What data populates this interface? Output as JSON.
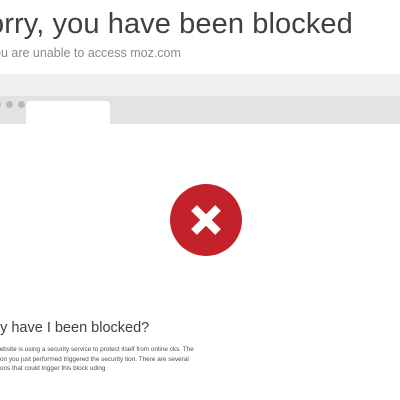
{
  "header": {
    "title": "orry, you have been blocked",
    "subtitle": "ou are unable to access moz.com"
  },
  "browser_mock": {
    "dots": [
      "dot",
      "dot",
      "dot"
    ]
  },
  "blocked_icon": {
    "icon": "close-x-icon",
    "color": "#c4222a"
  },
  "why_section": {
    "title": "hy have I been blocked?",
    "body": "s website is using a security service to protect itself from online cks. The action you just performed triggered the security tion. There are several actions that could trigger this block uding"
  }
}
